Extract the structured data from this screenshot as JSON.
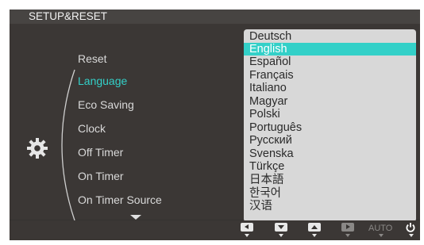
{
  "title": "SETUP&RESET",
  "menu": {
    "items": [
      {
        "label": "Reset",
        "active": false
      },
      {
        "label": "Language",
        "active": true
      },
      {
        "label": "Eco Saving",
        "active": false
      },
      {
        "label": "Clock",
        "active": false
      },
      {
        "label": "Off Timer",
        "active": false
      },
      {
        "label": "On Timer",
        "active": false
      },
      {
        "label": "On Timer Source",
        "active": false
      }
    ],
    "colons": [
      ":",
      ":"
    ]
  },
  "language_dropdown": {
    "options": [
      "Deutsch",
      "English",
      "Español",
      "Français",
      "Italiano",
      "Magyar",
      "Polski",
      "Português",
      "Русский",
      "Svenska",
      "Türkçe",
      "日本語",
      "한국어",
      "汉语"
    ],
    "selected": "English"
  },
  "controls": {
    "auto_label": "AUTO",
    "buttons": [
      "left-button",
      "down-button",
      "up-button",
      "enter-button",
      "auto-button",
      "power-button"
    ]
  },
  "colors": {
    "accent": "#33d0c8",
    "panel": "#3b3735",
    "titlebar": "#474442",
    "dropdown": "#d8d8d8"
  }
}
